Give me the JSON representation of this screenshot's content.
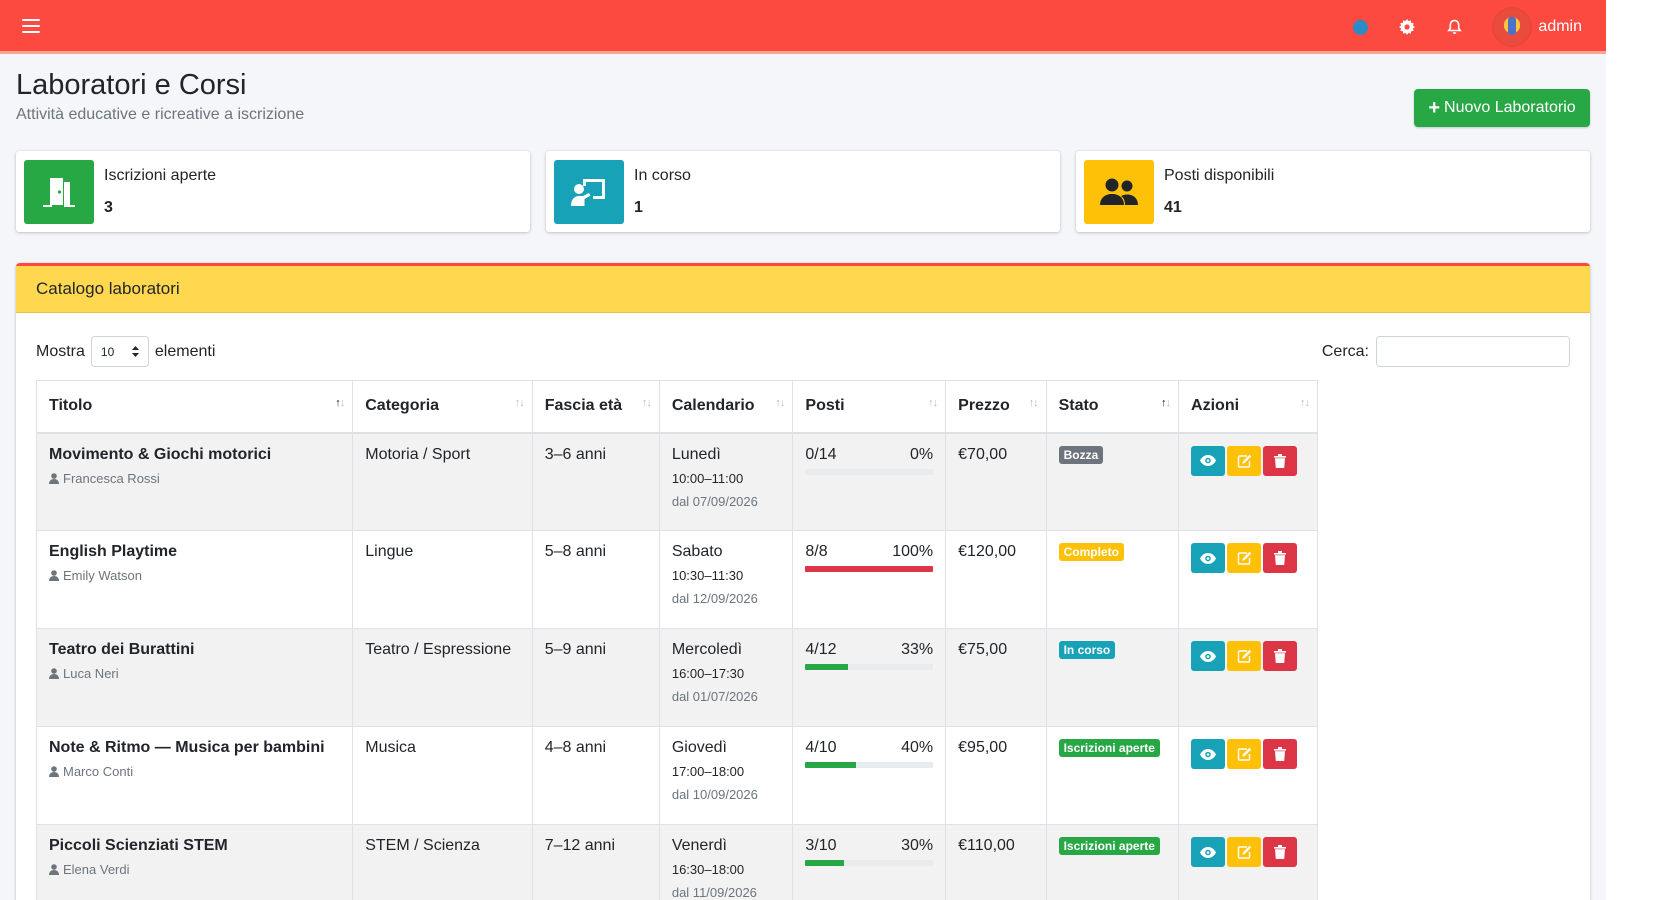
{
  "navbar": {
    "username": "admin",
    "icons": [
      "bars-icon",
      "globe-icon",
      "gear-icon",
      "bell-icon",
      "avatar"
    ],
    "colors": {
      "bar": "#fd4a40"
    }
  },
  "header": {
    "title": "Laboratori e Corsi",
    "subtitle": "Attività educative e ricreative a iscrizione",
    "new_button": "Nuovo Laboratorio"
  },
  "stats": [
    {
      "label": "Iscrizioni aperte",
      "value": "3",
      "icon": "door-open-icon",
      "color": "#28a745"
    },
    {
      "label": "In corso",
      "value": "1",
      "icon": "chalkboard-teacher-icon",
      "color": "#17a2b8"
    },
    {
      "label": "Posti disponibili",
      "value": "41",
      "icon": "users-icon",
      "color": "#ffc107"
    }
  ],
  "catalog": {
    "title": "Catalogo laboratori",
    "length_prefix": "Mostra",
    "length_value": "10",
    "length_suffix": "elementi",
    "search_label": "Cerca:",
    "search_value": "",
    "columns": [
      "Titolo",
      "Categoria",
      "Fascia età",
      "Calendario",
      "Posti",
      "Prezzo",
      "Stato",
      "Azioni"
    ],
    "rows": [
      {
        "title": "Movimento & Giochi motorici",
        "teacher": "Francesca Rossi",
        "category": "Motoria / Sport",
        "age": "3–6 anni",
        "day": "Lunedì",
        "time": "10:00–11:00",
        "from": "dal 07/09/2026",
        "seats": "0/14",
        "percent": "0%",
        "fill": 0,
        "bar_color": "#28a745",
        "price": "€70,00",
        "status": "Bozza",
        "status_color": "#6c757d"
      },
      {
        "title": "English Playtime",
        "teacher": "Emily Watson",
        "category": "Lingue",
        "age": "5–8 anni",
        "day": "Sabato",
        "time": "10:30–11:30",
        "from": "dal 12/09/2026",
        "seats": "8/8",
        "percent": "100%",
        "fill": 100,
        "bar_color": "#dc3545",
        "price": "€120,00",
        "status": "Completo",
        "status_color": "#ffc107"
      },
      {
        "title": "Teatro dei Burattini",
        "teacher": "Luca Neri",
        "category": "Teatro / Espressione",
        "age": "5–9 anni",
        "day": "Mercoledì",
        "time": "16:00–17:30",
        "from": "dal 01/07/2026",
        "seats": "4/12",
        "percent": "33%",
        "fill": 33,
        "bar_color": "#28a745",
        "price": "€75,00",
        "status": "In corso",
        "status_color": "#17a2b8"
      },
      {
        "title": "Note & Ritmo — Musica per bambini",
        "teacher": "Marco Conti",
        "category": "Musica",
        "age": "4–8 anni",
        "day": "Giovedì",
        "time": "17:00–18:00",
        "from": "dal 10/09/2026",
        "seats": "4/10",
        "percent": "40%",
        "fill": 40,
        "bar_color": "#28a745",
        "price": "€95,00",
        "status": "Iscrizioni aperte",
        "status_color": "#28a745"
      },
      {
        "title": "Piccoli Scienziati STEM",
        "teacher": "Elena Verdi",
        "category": "STEM / Scienza",
        "age": "7–12 anni",
        "day": "Venerdì",
        "time": "16:30–18:00",
        "from": "dal 11/09/2026",
        "seats": "3/10",
        "percent": "30%",
        "fill": 30,
        "bar_color": "#28a745",
        "price": "€110,00",
        "status": "Iscrizioni aperte",
        "status_color": "#28a745"
      }
    ]
  }
}
